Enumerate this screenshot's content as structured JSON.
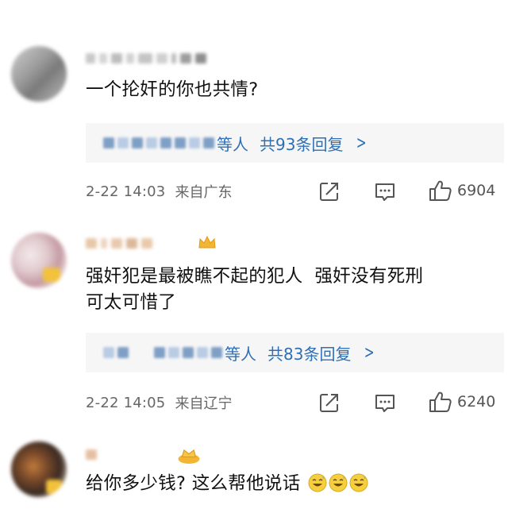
{
  "comments": [
    {
      "text": "一个抡奸的你也共情?",
      "reply": {
        "suffix": "等人",
        "count_text": "共93条回复",
        "chevron": ">"
      },
      "time": "2-22 14:03",
      "location": "来自广东",
      "likes": "6904"
    },
    {
      "text_line1": "强奸犯是最被瞧不起的犯人  强奸没有死刑",
      "text_line2": "可太可惜了",
      "reply": {
        "suffix": "等人",
        "count_text": "共83条回复",
        "chevron": ">"
      },
      "time": "2-22 14:05",
      "location": "来自辽宁",
      "likes": "6240"
    },
    {
      "text": "给你多少钱? 这么帮他说话",
      "emoji": "sweat-smile-emoji"
    }
  ],
  "icons": {
    "share": "share-icon",
    "comment": "comment-icon",
    "like": "thumbs-up-icon",
    "crown": "crown-badge-icon"
  },
  "colors": {
    "link_blue": "#2f6fb5",
    "reply_bg": "#f6f6f6",
    "meta_gray": "#666666",
    "crown_gold": "#f2b632"
  }
}
